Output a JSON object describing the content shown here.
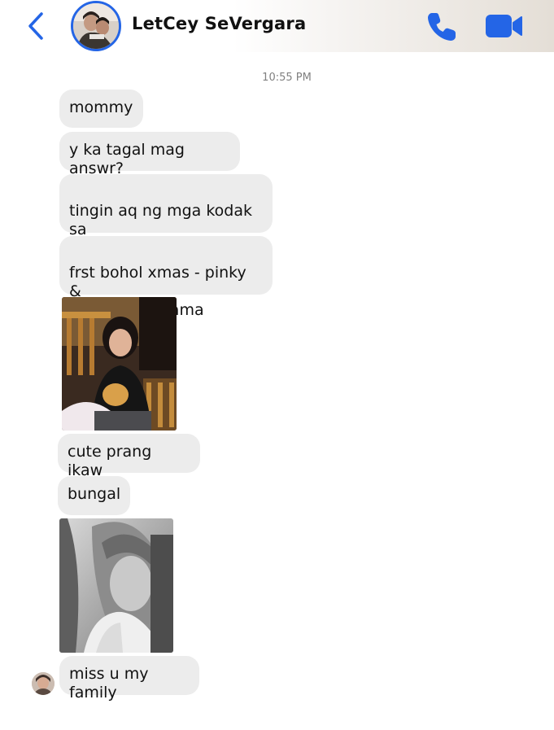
{
  "header": {
    "contact_name": "LetCey SeVergara",
    "back_icon": "chevron-left-icon",
    "call_icon": "phone-icon",
    "video_icon": "video-camera-icon",
    "accent_color": "#2465e6"
  },
  "conversation": {
    "timestamp": "10:55 PM",
    "messages": [
      {
        "type": "text",
        "text": "mommy"
      },
      {
        "type": "text",
        "text": "y ka tagal mag answr?"
      },
      {
        "type": "text",
        "text": "tingin aq ng mga kodak sa\nalbum ni mama"
      },
      {
        "type": "text",
        "text": "frst bohol xmas - pinky &\nmommy & mama"
      },
      {
        "type": "photo"
      },
      {
        "type": "text",
        "text": "cute prang ikaw"
      },
      {
        "type": "text",
        "text": "bungal"
      },
      {
        "type": "photo"
      },
      {
        "type": "text",
        "text": "miss u my family"
      }
    ],
    "bubble_color": "#ececec"
  }
}
